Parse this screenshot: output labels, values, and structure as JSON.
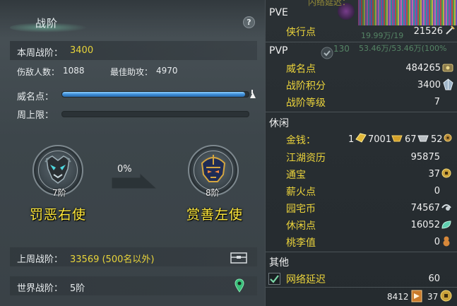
{
  "left": {
    "title": "战阶",
    "weekly_rank_label": "本周战阶：",
    "weekly_rank_value": "3400",
    "enemies_label": "伤敌人数：",
    "enemies_value": "1088",
    "best_assist_label": "最佳助攻：",
    "best_assist_value": "4970",
    "prestige_label": "威名点：",
    "prestige_progress": 0.98,
    "weekly_cap_label": "周上限：",
    "weekly_cap_progress": 0,
    "current_rank": {
      "level": "7阶",
      "name": "罚恶右使"
    },
    "next_rank": {
      "level": "8阶",
      "name": "赏善左使"
    },
    "progress_text": "0%",
    "last_week_label": "上周战阶：",
    "last_week_value": "33569 (500名以外)",
    "world_rank_label": "世界战阶：",
    "world_rank_value": "5阶"
  },
  "right": {
    "top_ghost": {
      "text1": "内络延迟：",
      "text2": "19.99万/19",
      "text3": "53.46万/53.46万(100%",
      "badge": "130"
    },
    "pve": {
      "title": "PVE",
      "rows": [
        {
          "label": "侠行点",
          "value": "21526"
        }
      ]
    },
    "pvp": {
      "title": "PVP",
      "rows": [
        {
          "label": "威名点",
          "value": "484265"
        },
        {
          "label": "战阶积分",
          "value": "3400"
        },
        {
          "label": "战阶等级",
          "value": "7"
        }
      ]
    },
    "leisure": {
      "title": "休闲",
      "money": {
        "label": "金钱：",
        "gold_bar": "1",
        "gold": "7001",
        "silver": "67",
        "copper": "52"
      },
      "rows": [
        {
          "label": "江湖资历",
          "value": "95875"
        },
        {
          "label": "通宝",
          "value": "37"
        },
        {
          "label": "薪火点",
          "value": "0"
        },
        {
          "label": "园宅币",
          "value": "74567"
        },
        {
          "label": "休闲点",
          "value": "16052"
        },
        {
          "label": "桃李值",
          "value": "0"
        }
      ]
    },
    "other": {
      "title": "其他",
      "latency_label": "网络延迟",
      "latency_value": "60",
      "latency_checked": true
    },
    "footer": {
      "value1": "8412",
      "value2": "37"
    }
  },
  "colors": {
    "accent_yellow": "#ecd43b",
    "rank_name": "#ffe83a",
    "progress_blue": "#3e8ed8"
  }
}
